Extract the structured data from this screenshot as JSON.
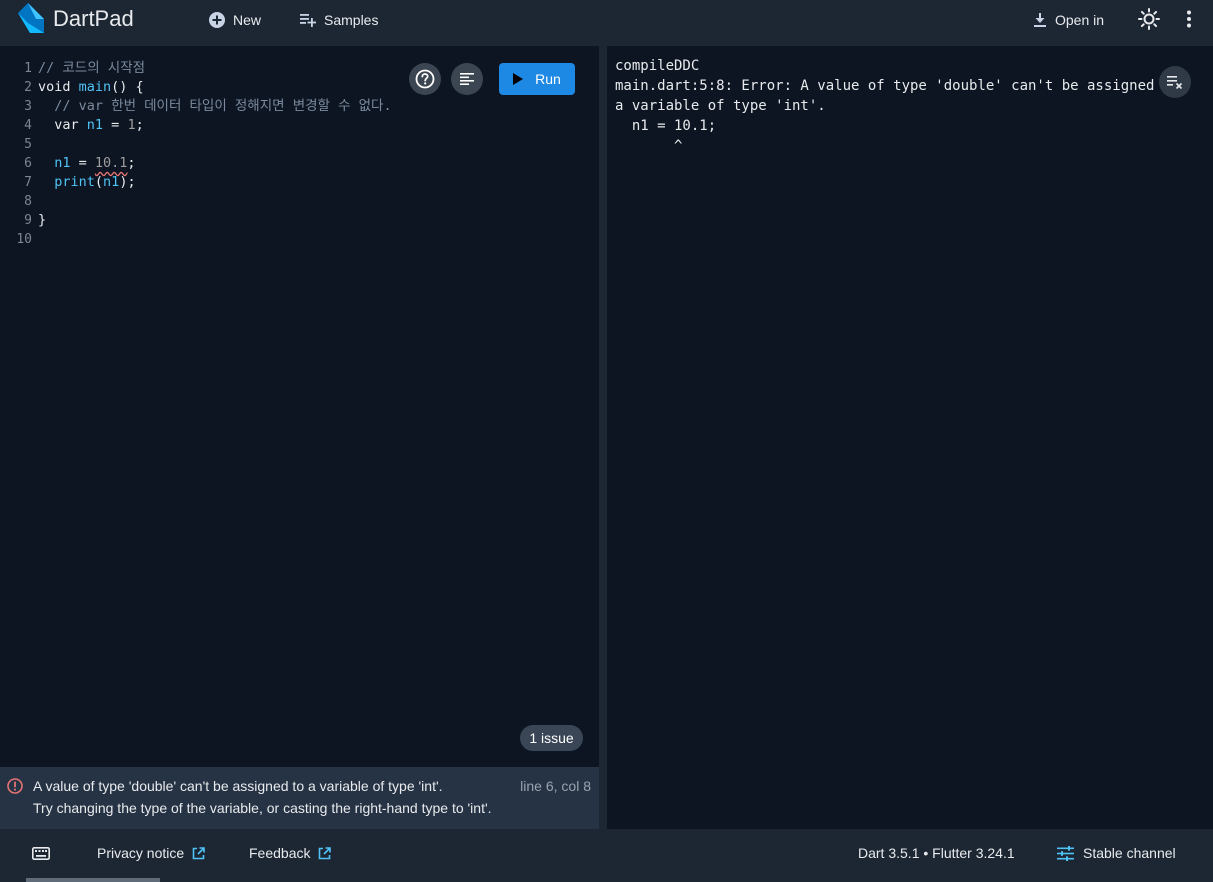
{
  "header": {
    "title": "DartPad",
    "new_label": "New",
    "samples_label": "Samples",
    "open_in_label": "Open in"
  },
  "editor": {
    "run_label": "Run",
    "line_numbers": [
      "1",
      "2",
      "3",
      "4",
      "5",
      "6",
      "7",
      "8",
      "9",
      "10"
    ],
    "line1": "// 코드의 시작점",
    "line2_kw": "void ",
    "line2_fn": "main",
    "line2_rest": "() {",
    "line3": "  // var 한번 데이터 타입이 정해지면 변경할 수 없다.",
    "line4_a": "  var ",
    "line4_var": "n1",
    "line4_b": " = ",
    "line4_num": "1",
    "line4_c": ";",
    "line6_var": "  n1",
    "line6_b": " = ",
    "line6_num": "10.1",
    "line6_c": ";",
    "line7_fn": "  print",
    "line7_b": "(",
    "line7_var": "n1",
    "line7_c": ");",
    "line9": "}",
    "issues_label": "1 issue"
  },
  "problem": {
    "message": "A value of type 'double' can't be assigned to a variable of type 'int'.",
    "hint": "Try changing the type of the variable, or casting the right-hand type to 'int'.",
    "location": "line 6, col 8"
  },
  "console": {
    "lines": [
      "compileDDC",
      "main.dart:5:8: Error: A value of type 'double' can't be assigned to",
      "a variable of type 'int'.",
      "  n1 = 10.1;",
      "       ^"
    ]
  },
  "footer": {
    "privacy_label": "Privacy notice",
    "feedback_label": "Feedback",
    "version_label": "Dart 3.5.1 • Flutter 3.24.1",
    "channel_label": "Stable channel"
  },
  "colors": {
    "accent": "#1e88e5",
    "error": "#e57373",
    "background": "#0c1521"
  }
}
